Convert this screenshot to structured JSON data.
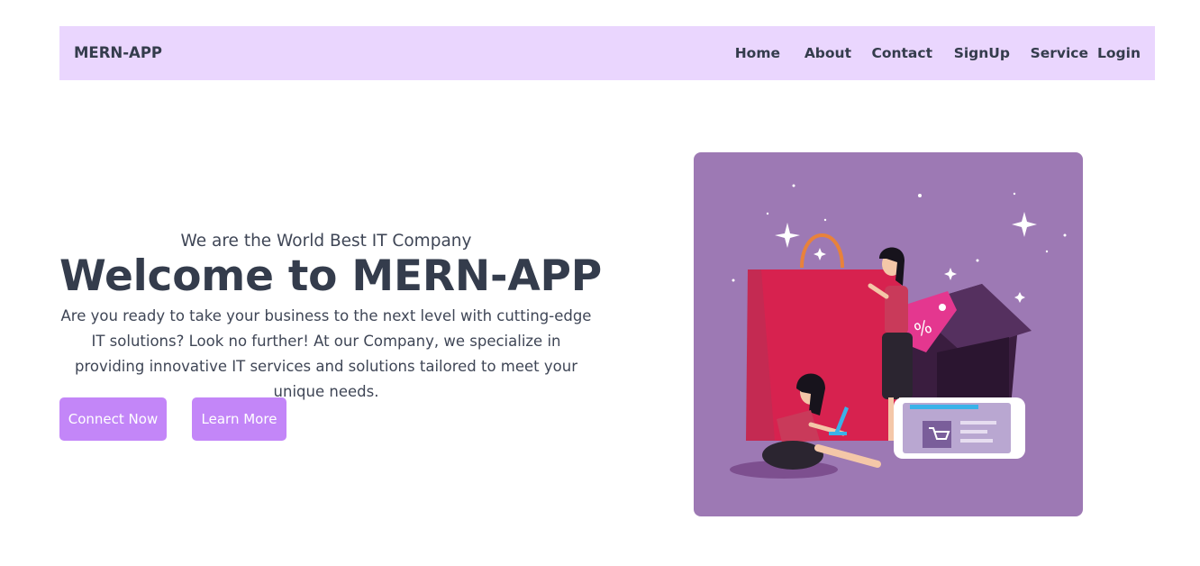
{
  "navbar": {
    "brand": "MERN-APP",
    "links": [
      {
        "label": "Home"
      },
      {
        "label": "About"
      },
      {
        "label": "Contact"
      },
      {
        "label": "SignUp"
      },
      {
        "label": "Service"
      },
      {
        "label": "Login"
      }
    ]
  },
  "hero": {
    "tagline": "We are the World Best IT Company",
    "title": "Welcome to MERN-APP",
    "description": "Are you ready to take your business to the next level with cutting-edge IT solutions? Look no further! At our Company, we specialize in providing innovative IT services and solutions tailored to meet your unique needs.",
    "buttons": {
      "connect": "Connect Now",
      "learn": "Learn More"
    },
    "illustration": {
      "icon": "shopping-illustration",
      "badge_text": "%"
    }
  },
  "colors": {
    "navbar_bg": "#ead6fe",
    "button_bg": "#c386f8",
    "illustration_bg": "#9d79b4",
    "text": "#343c4c"
  }
}
